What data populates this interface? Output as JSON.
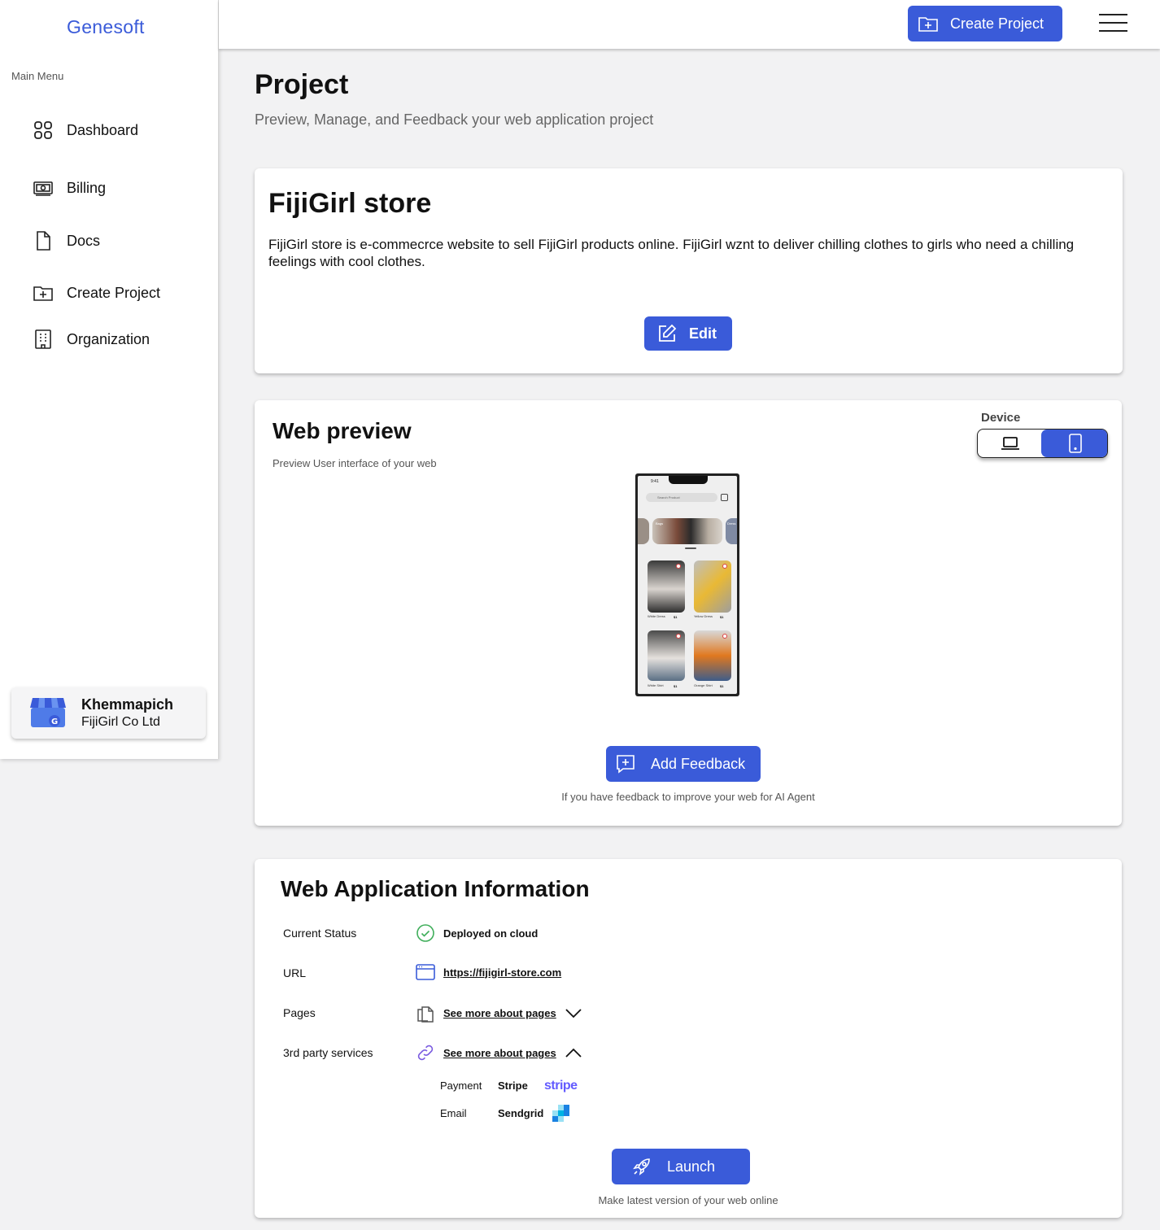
{
  "brand": "Genesoft",
  "sidebar": {
    "caption": "Main Menu",
    "items": [
      {
        "label": "Dashboard",
        "icon": "grid-icon"
      },
      {
        "label": "Billing",
        "icon": "cash-icon"
      },
      {
        "label": "Docs",
        "icon": "document-icon"
      },
      {
        "label": "Create Project",
        "icon": "folder-plus-icon"
      },
      {
        "label": "Organization",
        "icon": "building-icon"
      }
    ],
    "user": {
      "name": "Khemmapich",
      "org": "FijiGirl Co Ltd"
    }
  },
  "topbar": {
    "create_label": "Create Project"
  },
  "page": {
    "title": "Project",
    "subtitle": "Preview, Manage, and Feedback your web application project"
  },
  "project": {
    "name": "FijiGirl store",
    "description": "FijiGirl store is e-commecrce website to sell FijiGirl products online. FijiGirl wznt to deliver chilling clothes to girls who need a chilling feelings with cool clothes.",
    "edit_label": "Edit"
  },
  "preview": {
    "title": "Web preview",
    "subtitle": "Preview User interface of your web",
    "device_label": "Device",
    "selected_device": "mobile",
    "phone": {
      "time": "9:41",
      "search_placeholder": "Search Product",
      "banner_labels": [
        "Bags",
        "Dress"
      ],
      "products": [
        {
          "name": "White Dress",
          "price": "$1"
        },
        {
          "name": "Yellow Dress",
          "price": "$1"
        },
        {
          "name": "White Shirt",
          "price": "$1"
        },
        {
          "name": "Orange Shirt",
          "price": "$1"
        }
      ]
    },
    "feedback_label": "Add Feedback",
    "feedback_note": "If you have feedback to improve your web for AI Agent"
  },
  "info": {
    "title": "Web Application Information",
    "status_label": "Current Status",
    "status_value": "Deployed on cloud",
    "url_label": "URL",
    "url_value": "https://fijigirl-store.com",
    "pages_label": "Pages",
    "pages_link": "See more about pages",
    "services_label": "3rd party services",
    "services_link": "See more about pages",
    "services": [
      {
        "type": "Payment",
        "name": "Stripe",
        "logo_text": "stripe"
      },
      {
        "type": "Email",
        "name": "Sendgrid"
      }
    ],
    "launch_label": "Launch",
    "launch_note": "Make latest version of your web online"
  },
  "colors": {
    "accent": "#3a5bd9",
    "success": "#3fae5a",
    "stripe": "#635bff"
  }
}
